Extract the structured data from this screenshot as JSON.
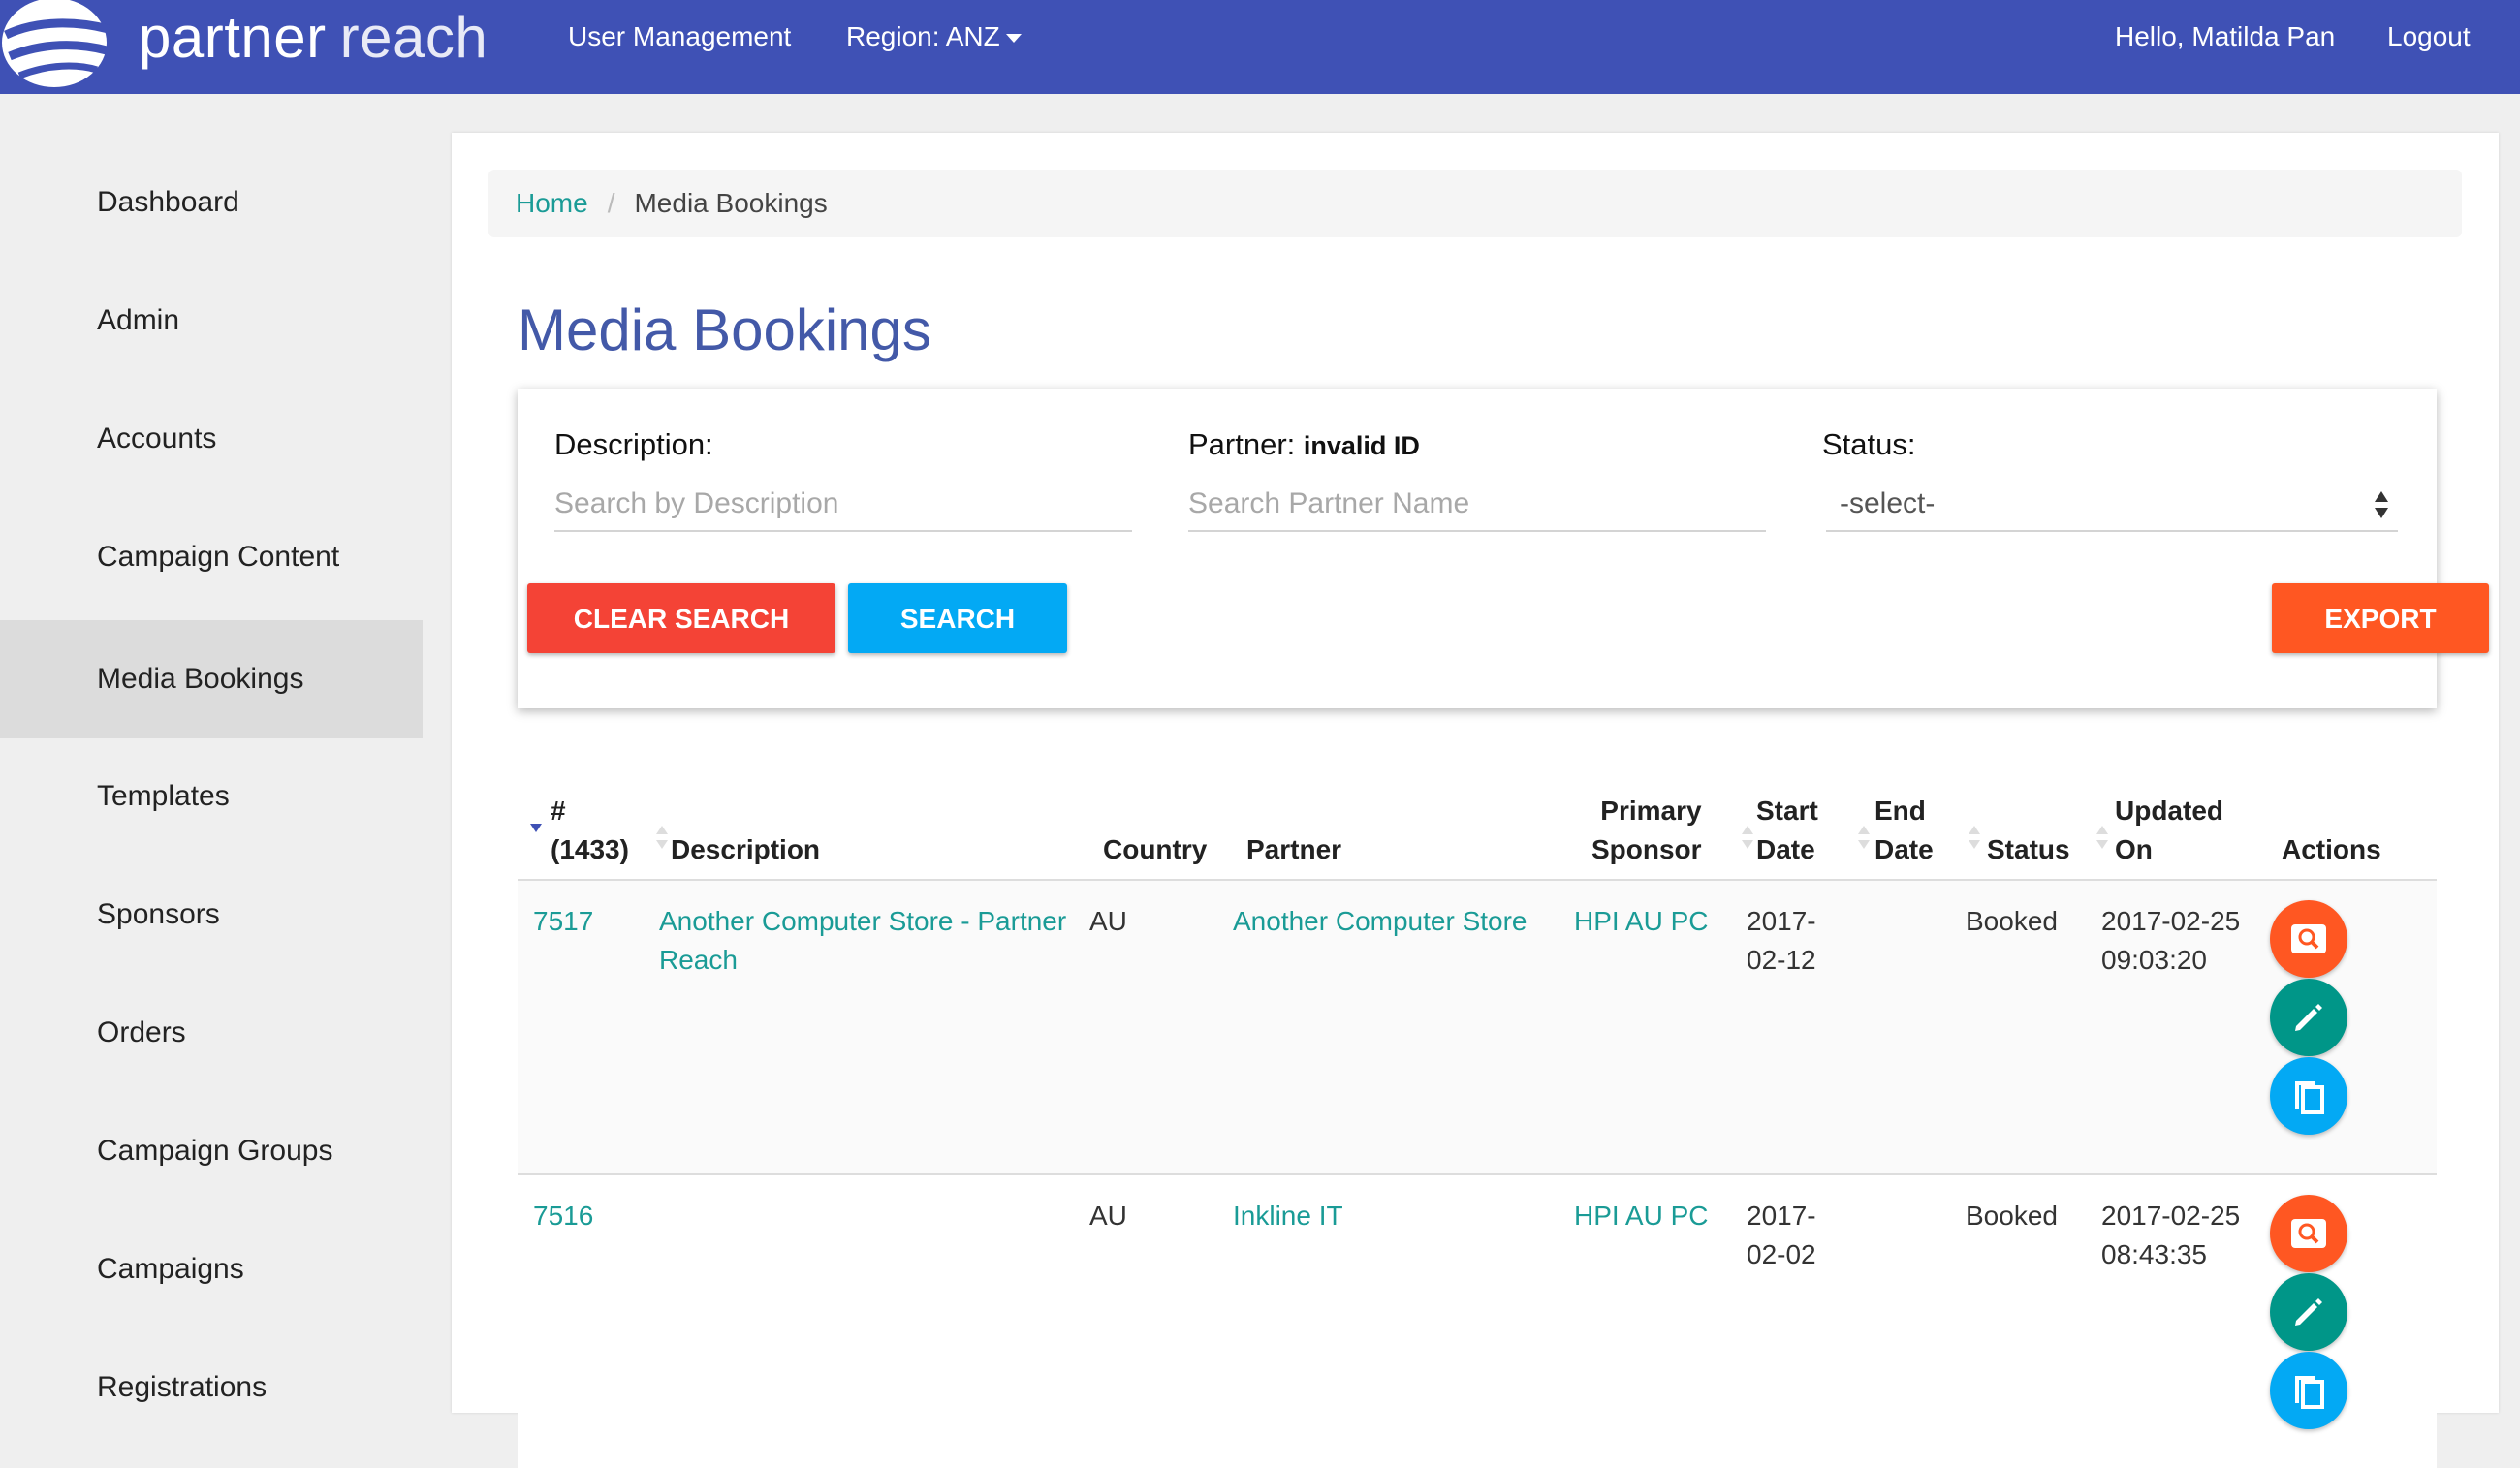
{
  "navbar": {
    "brand_part1": "partner",
    "brand_part2": "reach",
    "user_management": "User Management",
    "region": "Region: ANZ",
    "greeting": "Hello, Matilda Pan",
    "logout": "Logout",
    "color": "#3f51b5"
  },
  "sidebar": {
    "items": [
      {
        "label": "Dashboard"
      },
      {
        "label": "Admin"
      },
      {
        "label": "Accounts"
      },
      {
        "label": "Campaign Content"
      },
      {
        "label": "Media Bookings",
        "active": true
      },
      {
        "label": "Templates"
      },
      {
        "label": "Sponsors"
      },
      {
        "label": "Orders"
      },
      {
        "label": "Campaign Groups"
      },
      {
        "label": "Campaigns"
      },
      {
        "label": "Registrations"
      }
    ]
  },
  "breadcrumb": {
    "home": "Home",
    "separator": "/",
    "current": "Media Bookings"
  },
  "page": {
    "title": "Media Bookings"
  },
  "search": {
    "description_label": "Description:",
    "description_placeholder": "Search by Description",
    "partner_label": "Partner:",
    "partner_note": "invalid ID",
    "partner_placeholder": "Search Partner Name",
    "status_label": "Status:",
    "status_selected": "-select-",
    "clear_button": "CLEAR SEARCH",
    "search_button": "SEARCH",
    "export_button": "EXPORT"
  },
  "table": {
    "headers": {
      "id_line1": "#",
      "id_line2": "(1433)",
      "description": "Description",
      "country": "Country",
      "partner": "Partner",
      "sponsor_line1": "Primary",
      "sponsor_line2": "Sponsor",
      "start_line1": "Start",
      "start_line2": "Date",
      "end_line1": "End",
      "end_line2": "Date",
      "status": "Status",
      "updated_line1": "Updated",
      "updated_line2": "On",
      "actions": "Actions"
    },
    "rows": [
      {
        "id": "7517",
        "description_line1": "Another Computer Store - Partner",
        "description_line2": "Reach",
        "country": "AU",
        "partner": "Another Computer Store",
        "sponsor": "HPI AU PC",
        "start_line1": "2017-",
        "start_line2": "02-12",
        "end": "",
        "status": "Booked",
        "updated_line1": "2017-02-25",
        "updated_line2": "09:03:20"
      },
      {
        "id": "7516",
        "description_line1": "",
        "description_line2": "",
        "country": "AU",
        "partner": "Inkline IT",
        "sponsor": "HPI AU PC",
        "start_line1": "2017-",
        "start_line2": "02-02",
        "end": "",
        "status": "Booked",
        "updated_line1": "2017-02-25",
        "updated_line2": "08:43:35"
      }
    ]
  },
  "colors": {
    "clear_button": "#f44336",
    "search_button": "#03a9f4",
    "export_button": "#ff5722",
    "link": "#1a9b96",
    "title": "#4359a8",
    "action_view": "#ff5722",
    "action_edit": "#009688",
    "action_copy": "#03a9f4"
  }
}
